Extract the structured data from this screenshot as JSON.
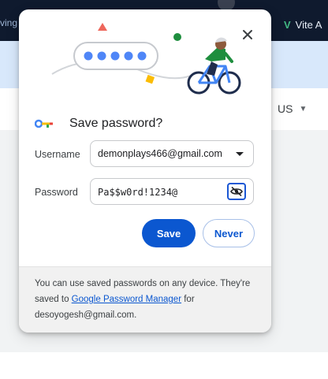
{
  "background": {
    "tab_fragment": "ving",
    "extension_label": "Vite A",
    "locale": "US"
  },
  "dialog": {
    "title": "Save password?",
    "username_label": "Username",
    "username_value": "demonplays466@gmail.com",
    "password_label": "Password",
    "password_value": "Pa$$w0rd!1234@",
    "save_button": "Save",
    "never_button": "Never",
    "footer": {
      "text_before": "You can use saved passwords on any device. They're saved to ",
      "link": "Google Password Manager",
      "text_after": " for desoyogesh@gmail.com."
    },
    "masked_dots_count": 5
  },
  "colors": {
    "accent": "#0b57d0",
    "dialog_bg": "#ffffff",
    "footer_bg": "#f1f1f1",
    "header_bar_bg": "#d8e8fb",
    "top_bar_bg": "#0f1a2e"
  },
  "icons": {
    "close": "close-icon",
    "key": "key-icon",
    "visibility_off": "eye-off-icon",
    "dropdown": "chevron-down-icon"
  }
}
